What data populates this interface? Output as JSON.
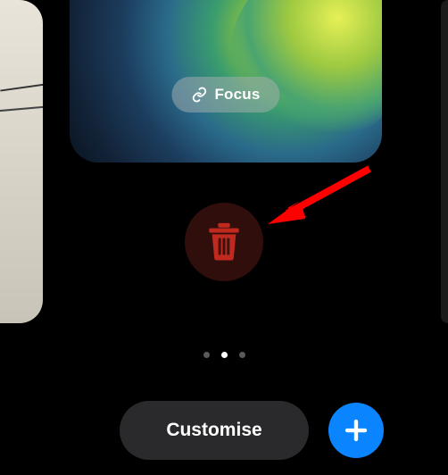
{
  "focus": {
    "label": "Focus"
  },
  "delete": {
    "icon": "trash-icon"
  },
  "pagination": {
    "total": 3,
    "current": 2
  },
  "bottom": {
    "customise_label": "Customise",
    "add_icon": "plus-icon"
  },
  "colors": {
    "accent": "#0a84ff",
    "delete": "#c0291e",
    "arrow": "#ff0000"
  }
}
